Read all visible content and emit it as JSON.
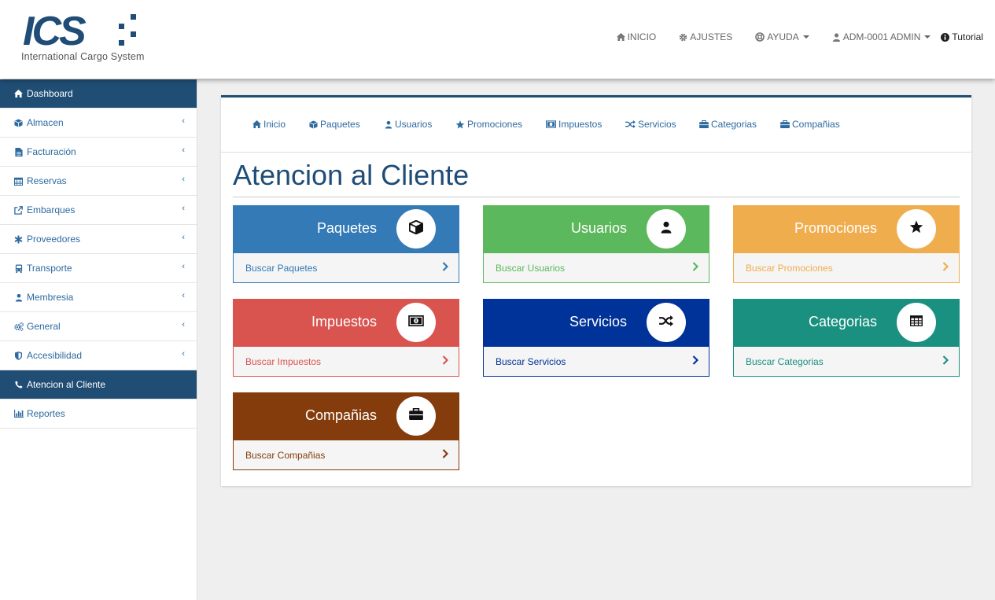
{
  "brand": {
    "logo_text": "ICS",
    "subtitle": "International Cargo System"
  },
  "topnav": {
    "inicio": "INICIO",
    "ajustes": "AJUSTES",
    "ayuda": "AYUDA",
    "user": "ADM-0001 ADMIN",
    "tutorial": "Tutorial"
  },
  "sidebar": {
    "items": [
      {
        "label": "Dashboard",
        "icon": "home-icon",
        "active": true
      },
      {
        "label": "Almacen",
        "icon": "cube-icon"
      },
      {
        "label": "Facturación",
        "icon": "file-icon"
      },
      {
        "label": "Reservas",
        "icon": "calendar-icon"
      },
      {
        "label": "Embarques",
        "icon": "external-link-icon"
      },
      {
        "label": "Proveedores",
        "icon": "asterisk-icon"
      },
      {
        "label": "Transporte",
        "icon": "bus-icon"
      },
      {
        "label": "Membresia",
        "icon": "user-icon"
      },
      {
        "label": "General",
        "icon": "cogs-icon"
      },
      {
        "label": "Accesibilidad",
        "icon": "shield-icon"
      },
      {
        "label": "Atencion al Cliente",
        "icon": "phone-icon",
        "active": true
      },
      {
        "label": "Reportes",
        "icon": "bar-chart-icon"
      }
    ]
  },
  "subnav": {
    "items": [
      {
        "label": "Inicio",
        "icon": "home-icon"
      },
      {
        "label": "Paquetes",
        "icon": "cube-icon"
      },
      {
        "label": "Usuarios",
        "icon": "user-icon"
      },
      {
        "label": "Promociones",
        "icon": "star-icon"
      },
      {
        "label": "Impuestos",
        "icon": "money-icon"
      },
      {
        "label": "Servicios",
        "icon": "random-icon"
      },
      {
        "label": "Categorias",
        "icon": "briefcase-icon"
      },
      {
        "label": "Compañias",
        "icon": "briefcase-icon"
      }
    ]
  },
  "page": {
    "title": "Atencion al Cliente"
  },
  "cards": [
    {
      "title": "Paquetes",
      "link": "Buscar Paquetes",
      "icon": "cube-icon",
      "color": "#337ab7"
    },
    {
      "title": "Usuarios",
      "link": "Buscar Usuarios",
      "icon": "user-icon",
      "color": "#5cb85c"
    },
    {
      "title": "Promociones",
      "link": "Buscar Promociones",
      "icon": "star-icon",
      "color": "#f0ad4e"
    },
    {
      "title": "Impuestos",
      "link": "Buscar Impuestos",
      "icon": "money-icon",
      "color": "#d9534f"
    },
    {
      "title": "Servicios",
      "link": "Buscar Servicios",
      "icon": "random-icon",
      "color": "#003399"
    },
    {
      "title": "Categorias",
      "link": "Buscar Categorias",
      "icon": "table-icon",
      "color": "#1a9080"
    },
    {
      "title": "Compañias",
      "link": "Buscar Compañias",
      "icon": "briefcase-icon",
      "color": "#843c0c"
    }
  ]
}
